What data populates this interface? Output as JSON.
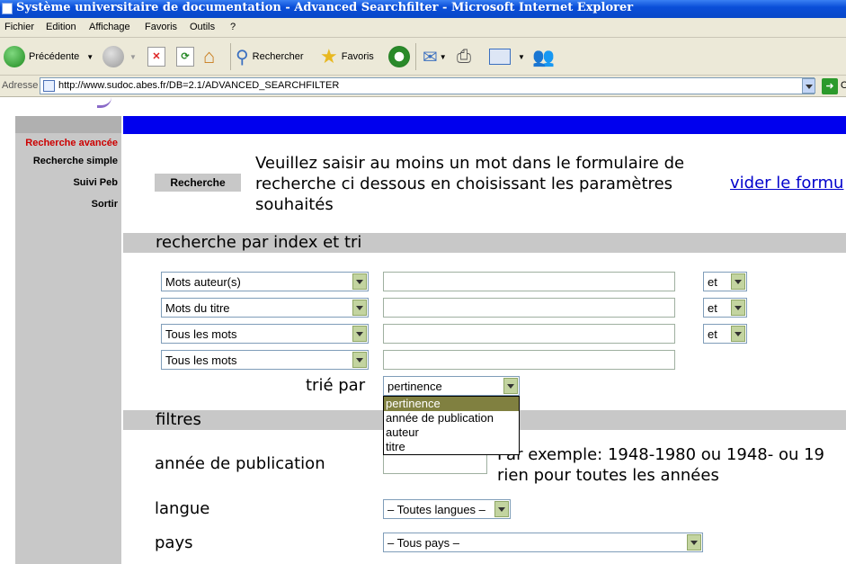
{
  "window": {
    "title": "Système universitaire de documentation - Advanced Searchfilter - Microsoft Internet Explorer"
  },
  "menubar": {
    "items": [
      "Fichier",
      "Edition",
      "Affichage",
      "Favoris",
      "Outils",
      "?"
    ]
  },
  "toolbar": {
    "back_label": "Précédente",
    "search_label": "Rechercher",
    "favorites_label": "Favoris"
  },
  "address": {
    "label": "Adresse",
    "url": "http://www.sudoc.abes.fr/DB=2.1/ADVANCED_SEARCHFILTER",
    "go_label": "O"
  },
  "sidebar": {
    "items": [
      {
        "label": "Recherche avancée",
        "color": "#cc0000"
      },
      {
        "label": "Recherche simple"
      },
      {
        "label": "Suivi Peb"
      },
      {
        "label": "Sortir"
      }
    ]
  },
  "main": {
    "search_button": "Recherche",
    "intro": "Veuillez saisir au moins un mot dans le formulaire de recherche ci dessous en choisissant les paramètres souhaités",
    "clear_link": "vider le formu",
    "index_section_title": "recherche par index et tri",
    "index_rows": [
      {
        "field": "Mots auteur(s)",
        "value": "",
        "operator": "et"
      },
      {
        "field": "Mots du titre",
        "value": "",
        "operator": "et"
      },
      {
        "field": "Tous les mots",
        "value": "",
        "operator": "et"
      },
      {
        "field": "Tous les mots",
        "value": ""
      }
    ],
    "sort_label": "trié par",
    "sort_selected": "pertinence",
    "sort_options": [
      "pertinence",
      "année de publication",
      "auteur",
      "titre"
    ],
    "filters_title": "filtres",
    "year_label": "année de publication",
    "year_hint": "Par exemple: 1948-1980 ou 1948- ou 19 rien pour toutes les années",
    "language_label": "langue",
    "language_selected": "– Toutes langues –",
    "country_label": "pays",
    "country_selected": "– Tous pays –"
  },
  "colors": {
    "header_bar": "#0000ee",
    "sidebar": "#c8c8c8",
    "link": "#0000cc",
    "active_nav": "#cc0000",
    "dropdown_highlight": "#808040"
  }
}
